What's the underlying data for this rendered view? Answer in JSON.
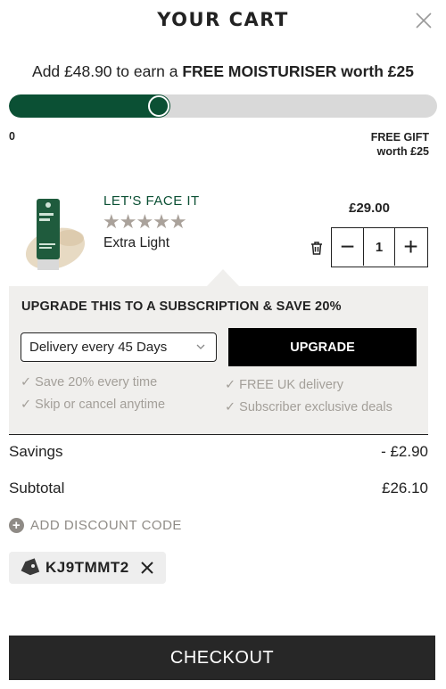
{
  "header": {
    "title": "YOUR CART"
  },
  "promo": {
    "prefix": "Add £48.90 to earn a ",
    "highlight": "FREE MOISTURISER worth £25"
  },
  "progress": {
    "fraction": 0.35,
    "start_label": "0",
    "end_label_line1": "FREE GIFT",
    "end_label_line2": "worth £25",
    "fill_color": "#0b5034",
    "track_color": "#d9d9d9"
  },
  "product": {
    "brand": "LET'S FACE IT",
    "rating": 5,
    "stars": "★★★★★",
    "variant": "Extra Light",
    "price": "£29.00",
    "quantity": "1",
    "decrement": "−",
    "increment": "+",
    "delete_icon": "trash-icon"
  },
  "subscription": {
    "title": "UPGRADE THIS TO A SUBSCRIPTION & SAVE 20%",
    "selected_option": "Delivery every 45 Days",
    "upgrade_label": "UPGRADE",
    "benefits": [
      "✓ Save 20% every time",
      "✓ Skip or cancel anytime",
      "✓ FREE UK delivery",
      "✓ Subscriber exclusive deals"
    ]
  },
  "summary": {
    "savings_label": "Savings",
    "savings_value": "- £2.90",
    "subtotal_label": "Subtotal",
    "subtotal_value": "£26.10"
  },
  "discount": {
    "add_label": "ADD DISCOUNT CODE",
    "applied_code": "KJ9TMMT2"
  },
  "checkout": {
    "label": "CHECKOUT"
  },
  "colors": {
    "brand_green": "#0b5034",
    "panel_bg": "#f0efed",
    "checkout_bg": "#272727"
  }
}
